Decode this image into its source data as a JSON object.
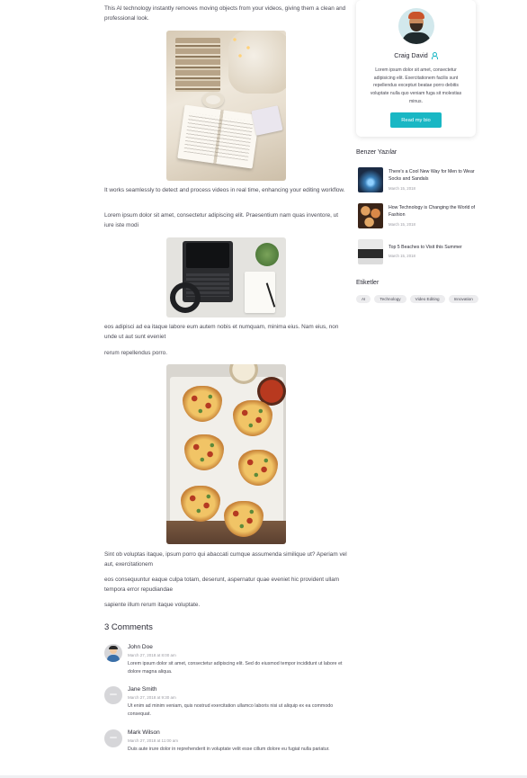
{
  "article": {
    "p1": "This AI technology instantly removes moving objects from your videos, giving them a clean and professional look.",
    "p2": "It works seamlessly to detect and process videos in real time, enhancing your editing workflow.",
    "p3": "Lorem ipsum dolor sit amet, consectetur adipiscing elit. Praesentium nam quas inventore, ut iure iste modi",
    "p4": "eos adipisci ad ea itaque labore eum autem nobis et numquam, minima eius. Nam eius, non unde ut aut sunt eveniet",
    "p5": "rerum repellendus porro.",
    "p6": "Sint ob voluptas itaque, ipsum porro qui abaccati cumque assumenda similique ut? Aperiam vel aut, exercitationem",
    "p7": "eos consequuntur eaque culpa totam, deserunt, aspernatur quae eveniet hic provident ullam tempora error repudiandae",
    "p8": "sapiente illum rerum itaque voluptate."
  },
  "comments": {
    "heading": "3 Comments",
    "items": [
      {
        "name": "John Doe",
        "date": "March 27, 2018 at 8:00 am",
        "text": "Lorem ipsum dolor sit amet, consectetur adipiscing elit. Sed do eiusmod tempor incididunt ut labore et dolore magna aliqua."
      },
      {
        "name": "Jane Smith",
        "date": "March 27, 2018 at 9:30 am",
        "text": "Ut enim ad minim veniam, quis nostrud exercitation ullamco laboris nisi ut aliquip ex ea commodo consequat."
      },
      {
        "name": "Mark Wilson",
        "date": "March 27, 2018 at 11:00 am",
        "text": "Duis aute irure dolor in reprehenderit in voluptate velit esse cillum dolore eu fugiat nulla pariatur."
      }
    ]
  },
  "profile": {
    "name": "Craig David",
    "bio": "Lorem ipsum dolor sit amet, consectetur adipisicing elit. Exercitationem facilis sunt repellendus excepturi beatae porro debitis voluptate nulla quo veniam fuga sit molestias minus.",
    "button": "Read my bio"
  },
  "related": {
    "title": "Benzer Yazılar",
    "posts": [
      {
        "title": "There's a Cool New Way for Men to Wear Socks and Sandals",
        "date": "March 15, 2018"
      },
      {
        "title": "How Technology is Changing the World of Fashion",
        "date": "March 15, 2018"
      },
      {
        "title": "Top 5 Beaches to Visit this Summer",
        "date": "March 15, 2018"
      }
    ]
  },
  "tags": {
    "title": "Etiketler",
    "items": [
      "AI",
      "Technology",
      "Video Editing",
      "Innovation"
    ]
  },
  "colors": {
    "accent": "#19b7c4",
    "text": "#4a4a55",
    "heading": "#2a2a35"
  }
}
